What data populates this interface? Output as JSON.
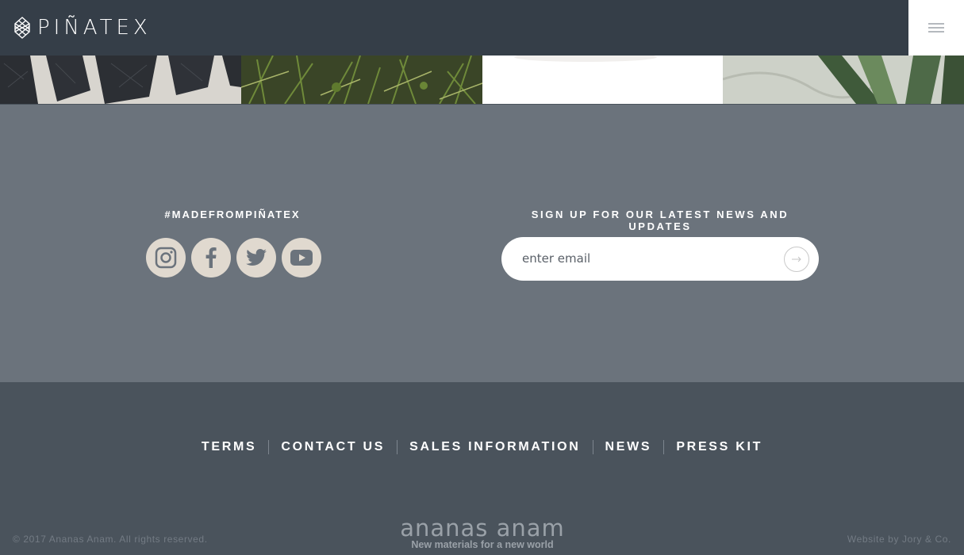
{
  "header": {
    "logo_text": "PIÑATEX",
    "menu_icon": "hamburger-icon"
  },
  "gallery": {
    "tiles": [
      "leather-wallets-image",
      "pineapple-plants-image",
      "white-product-image",
      "pineapple-leaf-image"
    ]
  },
  "social": {
    "heading": "#MADEFROMPIÑATEX",
    "icons": [
      "instagram-icon",
      "facebook-icon",
      "twitter-icon",
      "youtube-icon"
    ]
  },
  "signup": {
    "heading": "SIGN UP FOR OUR LATEST NEWS AND UPDATES",
    "placeholder": "enter email",
    "submit_icon": "arrow-right-icon"
  },
  "footer": {
    "links": [
      "TERMS",
      "CONTACT US",
      "SALES INFORMATION",
      "NEWS",
      "PRESS KIT"
    ],
    "copyright": "© 2017 Ananas Anam. All rights reserved.",
    "brand_name": "ananas anam",
    "brand_tagline": "New materials for a new world",
    "credit": "Website by Jory & Co."
  },
  "colors": {
    "header_bg": "#353e48",
    "band_bg": "#6b737c",
    "footer_bg": "#4a535c",
    "social_btn": "#e0d9cf"
  }
}
